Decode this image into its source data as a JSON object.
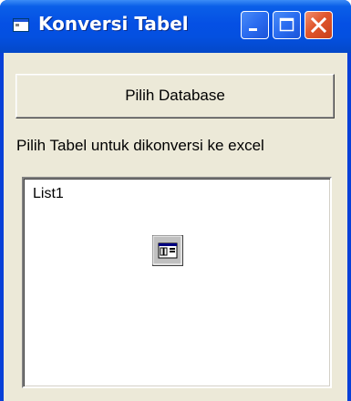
{
  "window": {
    "title": "Konversi Tabel",
    "icon": "app-window-icon",
    "controls": [
      "minimize-icon",
      "maximize-icon",
      "close-icon"
    ]
  },
  "main": {
    "select_db_button": "Pilih Database",
    "instruction_label": "Pilih Tabel untuk dikonversi ke excel",
    "listbox": {
      "items": [
        "List1"
      ],
      "design_icon": "listbox-control-icon"
    }
  },
  "colors": {
    "titlebar": "#0550e4",
    "client": "#ece9d8",
    "close_button": "#e0562c"
  }
}
